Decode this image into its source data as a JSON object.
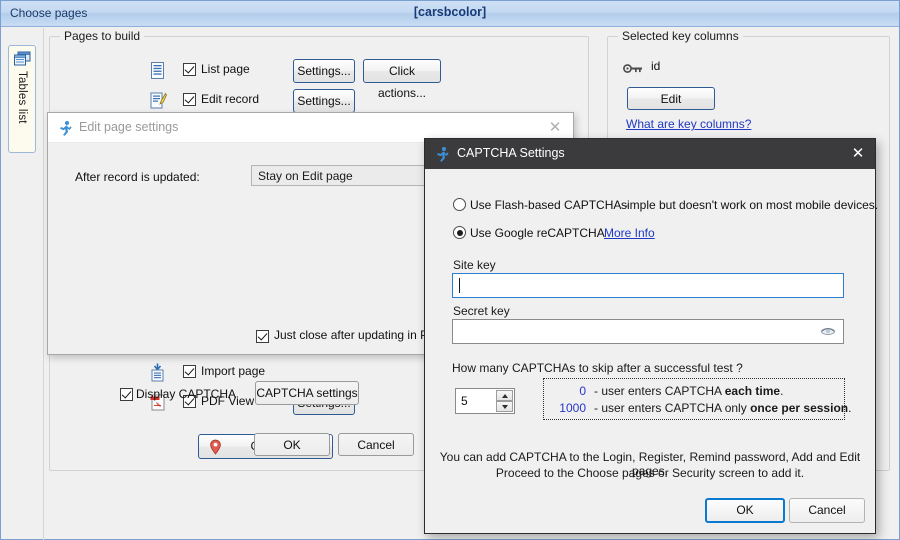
{
  "main_window": {
    "titlebar": {
      "left_label": "Choose pages",
      "center_label": "[carsbcolor]"
    },
    "side_tab": {
      "label": "Tables list",
      "icon": "windows-stack-icon"
    },
    "pages_group": {
      "title": "Pages to build",
      "rows": [
        {
          "icon": "list-page-icon",
          "label": "List page",
          "checked": true,
          "buttons": [
            "Settings...",
            "Click actions..."
          ]
        },
        {
          "icon": "edit-record-icon",
          "label": "Edit record",
          "checked": true,
          "buttons": [
            "Settings..."
          ]
        },
        {
          "icon": "import-page-icon",
          "label": "Import page",
          "checked": true,
          "buttons": []
        },
        {
          "icon": "pdf-view-icon",
          "label": "PDF View",
          "checked": true,
          "buttons": [
            "Settings..."
          ]
        }
      ],
      "geocoding_button": "Geocoding..."
    },
    "keys_group": {
      "title": "Selected key columns",
      "key_icon": "key-icon",
      "key_name": "id",
      "edit_button": "Edit",
      "help_link": "What are key columns?"
    }
  },
  "edit_page_dialog": {
    "title": "Edit page settings",
    "title_icon": "running-man-icon",
    "close_icon": "close-icon",
    "after_update_label": "After record is updated:",
    "after_update_value": "Stay on Edit page",
    "just_close": {
      "label": "Just close after updating in Popup Mode",
      "checked": true
    },
    "display_captcha": {
      "label": "Display CAPTCHA",
      "checked": true
    },
    "captcha_settings_button": "CAPTCHA settings",
    "ok_button": "OK",
    "cancel_button": "Cancel"
  },
  "captcha_dialog": {
    "title": "CAPTCHA Settings",
    "title_icon": "running-man-icon",
    "close_icon": "close-icon",
    "option_flash": {
      "label": "Use Flash-based CAPTCHA -",
      "note": "simple but doesn't work on most mobile devices.",
      "selected": false
    },
    "option_recaptcha": {
      "label": "Use Google reCAPTCHA",
      "selected": true,
      "more_info_link": "More Info"
    },
    "site_key": {
      "label": "Site key",
      "value": "",
      "focused": true
    },
    "secret_key": {
      "label": "Secret key",
      "value": "",
      "reveal_icon": "eye-icon"
    },
    "skip_question": "How many CAPTCHAs to skip after a successful test ?",
    "skip_value": "5",
    "spinner": {
      "up_icon": "chevron-up-icon",
      "down_icon": "chevron-down-icon"
    },
    "hints": [
      {
        "number": "0",
        "text_before": "- user enters CAPTCHA ",
        "bold": "each time",
        "text_after": "."
      },
      {
        "number": "1000",
        "text_before": "- user enters CAPTCHA only ",
        "bold": "once per session",
        "text_after": "."
      }
    ],
    "footer_note_line1": "You can add CAPTCHA to the Login, Register, Remind password, Add and Edit pages.",
    "footer_note_line2": "Proceed to the Choose pages or Security screen to add it.",
    "ok_button": "OK",
    "cancel_button": "Cancel"
  },
  "colors": {
    "titlebar_blue": "#b3cdeb",
    "title_text_blue": "#173a77",
    "dialog_dark": "#3b3b3d",
    "accent_blue": "#0a7ad1",
    "link_blue": "#1f39c4",
    "hint_number_blue": "#2636c9",
    "window_bg": "#f0f0f0"
  }
}
